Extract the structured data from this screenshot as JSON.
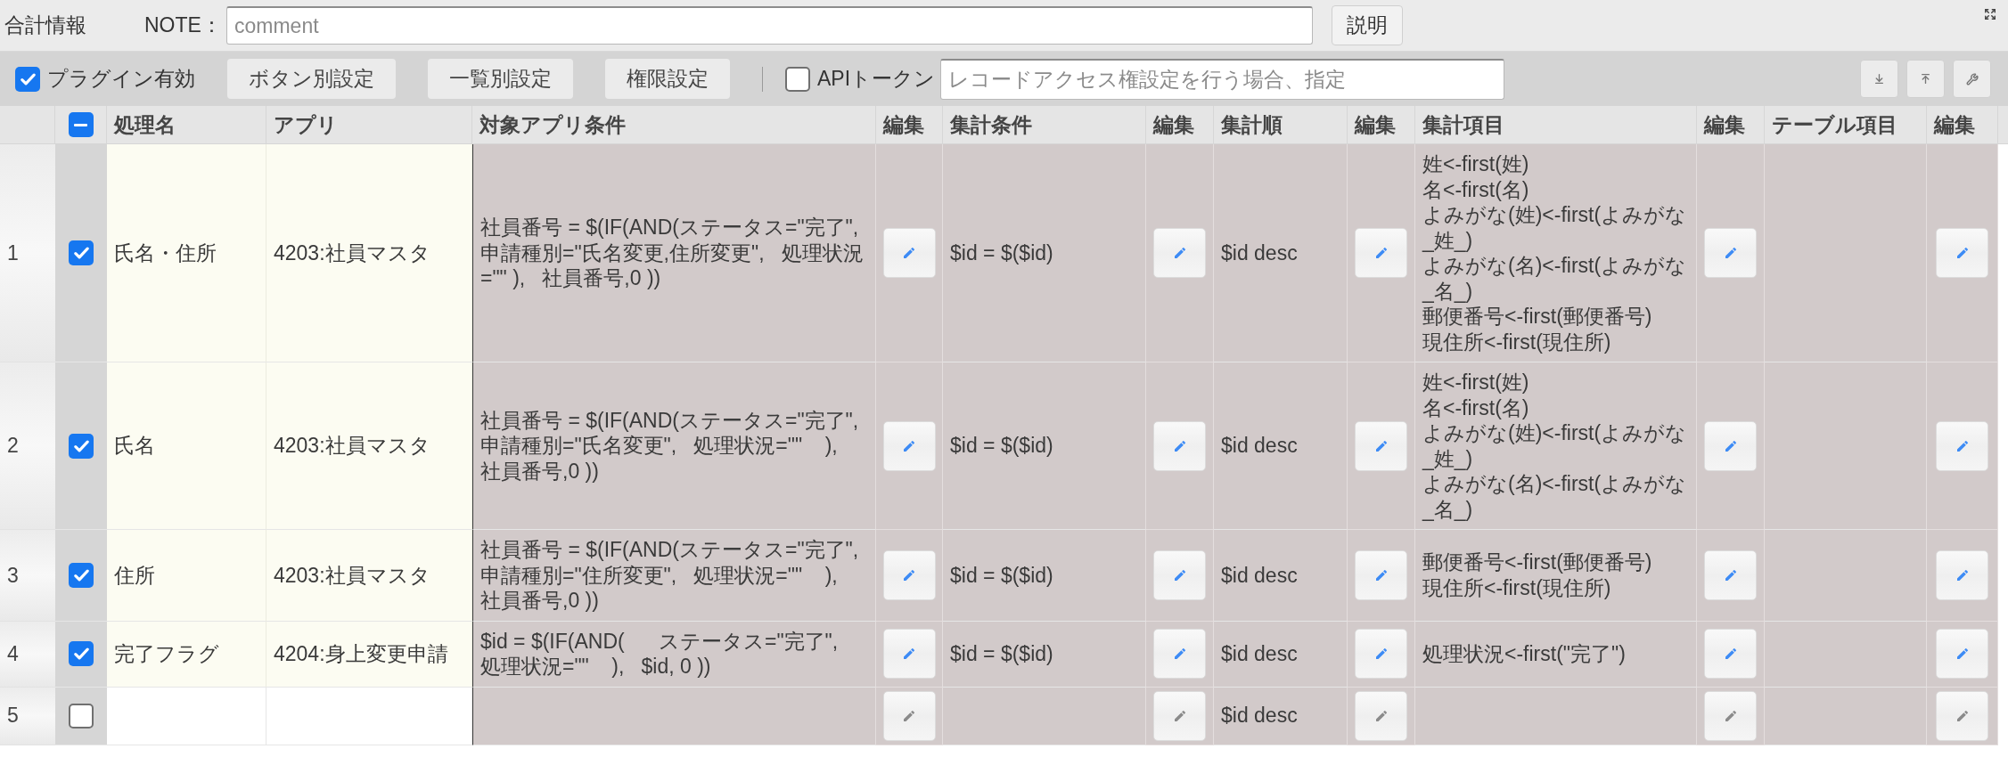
{
  "header": {
    "title": "合計情報",
    "note_label": "NOTE：",
    "note_field": {
      "placeholder": "comment"
    },
    "help_button": "説明"
  },
  "toolbar": {
    "plugin_enabled": {
      "label": "プラグイン有効",
      "checked": true
    },
    "buttons": [
      "ボタン別設定",
      "一覧別設定",
      "権限設定"
    ],
    "api_token": {
      "label": "APIトークン",
      "checked": false
    },
    "api_token_field": {
      "placeholder": "レコードアクセス権設定を行う場合、指定"
    }
  },
  "table": {
    "select_all": {
      "indeterminate": true
    },
    "columns": [
      {
        "label": "処理名",
        "kind": "input"
      },
      {
        "label": "アプリ",
        "kind": "input"
      },
      {
        "label": "対象アプリ条件",
        "kind": "text"
      },
      {
        "label": "編集",
        "kind": "button"
      },
      {
        "label": "集計条件",
        "kind": "text"
      },
      {
        "label": "編集",
        "kind": "button"
      },
      {
        "label": "集計順",
        "kind": "text"
      },
      {
        "label": "編集",
        "kind": "button"
      },
      {
        "label": "集計項目",
        "kind": "text"
      },
      {
        "label": "編集",
        "kind": "button"
      },
      {
        "label": "テーブル項目",
        "kind": "text"
      },
      {
        "label": "編集",
        "kind": "button"
      }
    ],
    "rows": [
      {
        "number": "1",
        "checked": true,
        "disabled": false,
        "name": "氏名・住所",
        "app": "4203:社員マスタ",
        "condition": "社員番号 = $(IF(AND(ステータス=\"完了\",   申請種別=\"氏名変更,住所変更\",   処理状況=\"\" ),   社員番号,0 ))",
        "agg_condition": "$id = $($id)",
        "agg_order": "$id desc",
        "agg_items": "姓<-first(姓)\n名<-first(名)\nよみがな(姓)<-first(よみがな_姓_)\nよみがな(名)<-first(よみがな_名_)\n郵便番号<-first(郵便番号)\n現住所<-first(現住所)"
      },
      {
        "number": "2",
        "checked": true,
        "disabled": false,
        "name": "氏名",
        "app": "4203:社員マスタ",
        "condition": "社員番号 = $(IF(AND(ステータス=\"完了\",   申請種別=\"氏名変更\",   処理状況=\"\"    ),   社員番号,0 ))",
        "agg_condition": "$id = $($id)",
        "agg_order": "$id desc",
        "agg_items": "姓<-first(姓)\n名<-first(名)\nよみがな(姓)<-first(よみがな_姓_)\nよみがな(名)<-first(よみがな_名_)"
      },
      {
        "number": "3",
        "checked": true,
        "disabled": false,
        "name": "住所",
        "app": "4203:社員マスタ",
        "condition": "社員番号 = $(IF(AND(ステータス=\"完了\",   申請種別=\"住所変更\",   処理状況=\"\"    ),   社員番号,0 ))",
        "agg_condition": "$id = $($id)",
        "agg_order": "$id desc",
        "agg_items": "郵便番号<-first(郵便番号)\n現住所<-first(現住所)"
      },
      {
        "number": "4",
        "checked": true,
        "disabled": false,
        "name": "完了フラグ",
        "app": "4204:身上変更申請",
        "condition": "$id = $(IF(AND(      ステータス=\"完了\",      処理状況=\"\"    ),   $id, 0 ))",
        "agg_condition": "$id = $($id)",
        "agg_order": "$id desc",
        "agg_items": "処理状況<-first(\"完了\")"
      },
      {
        "number": "5",
        "checked": false,
        "disabled": true,
        "agg_order": "$id desc"
      }
    ]
  }
}
